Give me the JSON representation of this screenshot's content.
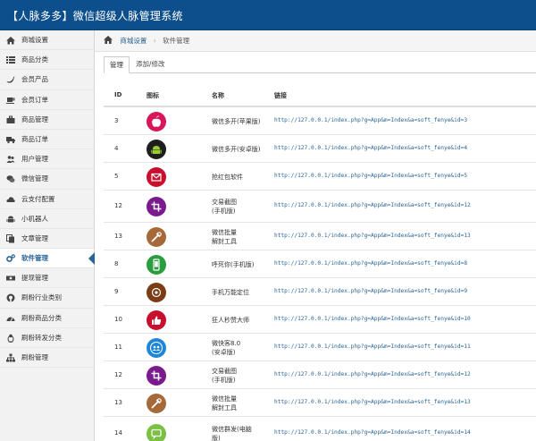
{
  "app": {
    "title": "【人脉多多】微信超级人脉管理系统"
  },
  "sidebar": {
    "items": [
      {
        "label": "商城设置",
        "icon": "home-icon"
      },
      {
        "label": "商品分类",
        "icon": "list-icon"
      },
      {
        "label": "会员产品",
        "icon": "twitter-bird-icon"
      },
      {
        "label": "会员订单",
        "icon": "cup-icon"
      },
      {
        "label": "商品管理",
        "icon": "briefcase-icon"
      },
      {
        "label": "商品订单",
        "icon": "truck-icon"
      },
      {
        "label": "用户管理",
        "icon": "users-icon"
      },
      {
        "label": "微信管理",
        "icon": "wechat-icon"
      },
      {
        "label": "云支付配置",
        "icon": "cloud-icon"
      },
      {
        "label": "小机器人",
        "icon": "android-icon"
      },
      {
        "label": "文章管理",
        "icon": "copy-icon"
      },
      {
        "label": "软件管理",
        "icon": "cogs-icon",
        "active": true
      },
      {
        "label": "提现管理",
        "icon": "money-icon"
      },
      {
        "label": "刷粉行业类别",
        "icon": "github-icon"
      },
      {
        "label": "刷粉商品分类",
        "icon": "tachometer-icon"
      },
      {
        "label": "刷粉转发分类",
        "icon": "linux-icon"
      },
      {
        "label": "刷粉管理",
        "icon": "sitemap-icon"
      }
    ]
  },
  "breadcrumb": {
    "parent": "商城设置",
    "separator": "›",
    "current": "软件管理"
  },
  "tabs": [
    {
      "label": "管理"
    },
    {
      "label": "添加/修改"
    }
  ],
  "table": {
    "headers": {
      "id": "ID",
      "icon": "图标",
      "name": "名称",
      "link": "链接"
    },
    "rows": [
      {
        "id": "3",
        "name": [
          "微信多开(苹果版)"
        ],
        "url": "http://127.0.0.1/index.php?g=App&m=Index&a=soft_fenye&id=3",
        "icon": "apple-icon",
        "color": "#d8175a"
      },
      {
        "id": "4",
        "name": [
          "微信多开(安卓版)"
        ],
        "url": "http://127.0.0.1/index.php?g=App&m=Index&a=soft_fenye&id=4",
        "icon": "android-icon",
        "color": "#1e1e1e"
      },
      {
        "id": "5",
        "name": [
          "抢红包软件"
        ],
        "url": "http://127.0.0.1/index.php?g=App&m=Index&a=soft_fenye&id=5",
        "icon": "envelope-icon",
        "color": "#c8102e"
      },
      {
        "id": "12",
        "name": [
          "交易截图",
          "(手机版)"
        ],
        "url": "http://127.0.0.1/index.php?g=App&m=Index&a=soft_fenye&id=12",
        "icon": "crop-icon",
        "color": "#7a1a8e"
      },
      {
        "id": "13",
        "name": [
          "微信批量",
          "解封工具"
        ],
        "url": "http://127.0.0.1/index.php?g=App&m=Index&a=soft_fenye&id=13",
        "icon": "wrench-icon",
        "color": "#a5693a"
      },
      {
        "id": "8",
        "name": [
          "呼死你(手机版)"
        ],
        "url": "http://127.0.0.1/index.php?g=App&m=Index&a=soft_fenye&id=8",
        "icon": "phone-icon",
        "color": "#2a9d3f"
      },
      {
        "id": "9",
        "name": [
          "手机万能定位"
        ],
        "url": "http://127.0.0.1/index.php?g=App&m=Index&a=soft_fenye&id=9",
        "icon": "target-icon",
        "color": "#7a3d15"
      },
      {
        "id": "10",
        "name": [
          "狂人秒赞大师"
        ],
        "url": "http://127.0.0.1/index.php?g=App&m=Index&a=soft_fenye&id=10",
        "icon": "thumbs-up-icon",
        "color": "#c8102e"
      },
      {
        "id": "11",
        "name": [
          "微快客8.0",
          "(安卓版)"
        ],
        "url": "http://127.0.0.1/index.php?g=App&m=Index&a=soft_fenye&id=11",
        "icon": "users-circle-icon",
        "color": "#1f86d8"
      },
      {
        "id": "12",
        "name": [
          "交易截图",
          "(手机版)"
        ],
        "url": "http://127.0.0.1/index.php?g=App&m=Index&a=soft_fenye&id=12",
        "icon": "crop-icon",
        "color": "#7a1a8e"
      },
      {
        "id": "13",
        "name": [
          "微信批量",
          "解封工具"
        ],
        "url": "http://127.0.0.1/index.php?g=App&m=Index&a=soft_fenye&id=13",
        "icon": "wrench-icon",
        "color": "#a5693a"
      },
      {
        "id": "14",
        "name": [
          "微信群发(电脑",
          "版)"
        ],
        "url": "http://127.0.0.1/index.php?g=App&m=Index&a=soft_fenye&id=14",
        "icon": "chat-icon",
        "color": "#7ac143"
      }
    ]
  }
}
